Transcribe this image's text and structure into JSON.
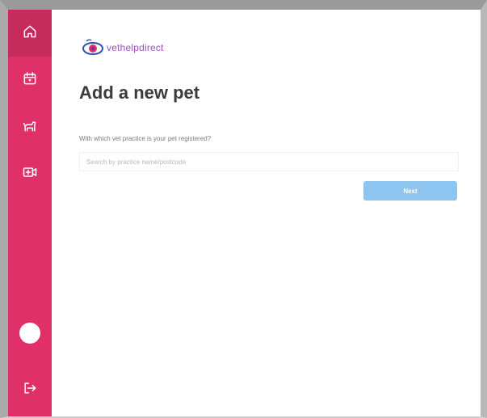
{
  "sidebar": {
    "items": [
      {
        "icon": "home-icon"
      },
      {
        "icon": "calendar-icon"
      },
      {
        "icon": "pet-icon"
      },
      {
        "icon": "video-call-icon"
      }
    ],
    "logout_icon": "logout-icon"
  },
  "brand": {
    "name": "vethelpdirect",
    "color": "#a14bc4"
  },
  "page": {
    "title": "Add a new pet",
    "question": "With which vet practice is your pet registered?",
    "search_placeholder": "Search by practice name/postcode",
    "next_label": "Next"
  },
  "colors": {
    "sidebar": "#e0306a",
    "sidebar_active": "#c72a5d",
    "button": "#8ec5f0",
    "title": "#3b3b3b"
  }
}
